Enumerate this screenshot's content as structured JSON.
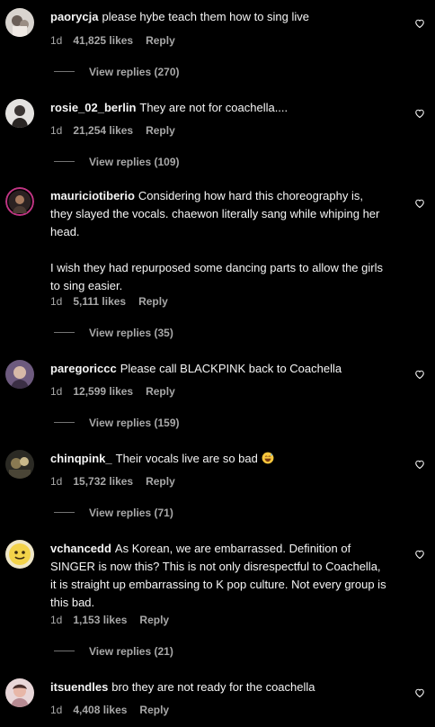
{
  "colors": {
    "background": "#000000",
    "text": "#f5f5f5",
    "secondary": "#a8a8a8",
    "divider": "#737373"
  },
  "comments": [
    {
      "username": "paorycja",
      "text": "please hybe teach them how to sing live",
      "time": "1d",
      "likes": "41,825 likes",
      "reply": "Reply",
      "view_replies": "View replies (270)",
      "avatar_icon": "avatar-light-photo-icon"
    },
    {
      "username": "rosie_02_berlin",
      "text": "They are not for coachella....",
      "time": "1d",
      "likes": "21,254 likes",
      "reply": "Reply",
      "view_replies": "View replies (109)",
      "avatar_icon": "avatar-grey-portrait-icon"
    },
    {
      "username": "mauriciotiberio",
      "text": "Considering how hard this choreography is, they slayed the vocals. chaewon literally sang while whiping her head.\n\nI wish they had repurposed some dancing parts to allow the girls to sing easier.",
      "time": "1d",
      "likes": "5,111 likes",
      "reply": "Reply",
      "view_replies": "View replies (35)",
      "avatar_icon": "avatar-story-ring-icon"
    },
    {
      "username": "paregoriccc",
      "text": "Please call BLACKPINK back to Coachella",
      "time": "1d",
      "likes": "12,599 likes",
      "reply": "Reply",
      "view_replies": "View replies (159)",
      "avatar_icon": "avatar-purple-portrait-icon"
    },
    {
      "username": "chinqpink_",
      "text": "Their vocals live are so bad",
      "emoji": "grinning-sweat-emoji-icon",
      "time": "1d",
      "likes": "15,732 likes",
      "reply": "Reply",
      "view_replies": "View replies (71)",
      "avatar_icon": "avatar-dark-photo-icon"
    },
    {
      "username": "vchancedd",
      "text": "As Korean, we are embarrassed. Definition of SINGER is now this? This is not only disrespectful to Coachella, it is straight up embarrassing to K pop culture. Not every group is this bad.",
      "time": "1d",
      "likes": "1,153 likes",
      "reply": "Reply",
      "view_replies": "View replies (21)",
      "avatar_icon": "avatar-yellow-emoji-icon"
    },
    {
      "username": "itsuendles",
      "text": "bro they are not ready for the coachella",
      "time": "1d",
      "likes": "4,408 likes",
      "reply": "Reply",
      "avatar_icon": "avatar-pink-portrait-icon"
    }
  ]
}
